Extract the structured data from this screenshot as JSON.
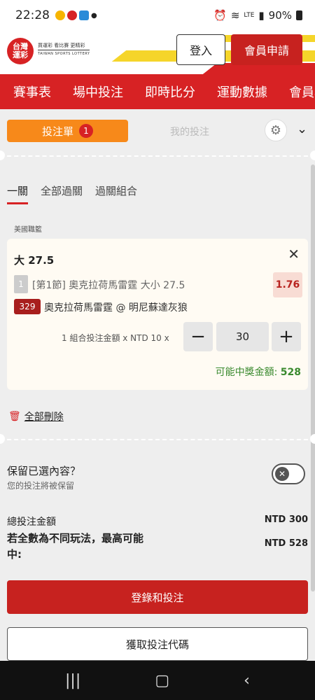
{
  "status_bar": {
    "time": "22:28",
    "battery": "90%",
    "network": "LTE"
  },
  "header": {
    "logo_text": "台灣\n運彩",
    "logo_tagline": "買運彩 看比賽 更精彩",
    "logo_sub": "TAIWAN SPORTS LOTTERY",
    "login_label": "登入",
    "register_label": "會員申請"
  },
  "nav": {
    "items": [
      "賽事表",
      "場中投注",
      "即時比分",
      "運動數據",
      "會員專"
    ]
  },
  "slip": {
    "tab_slip_label": "投注單",
    "slip_count": "1",
    "tab_mine_label": "我的投注",
    "subtabs": [
      "一關",
      "全部過關",
      "過關組合"
    ],
    "league": "美國職籃",
    "bet": {
      "selection": "大 27.5",
      "leg_number": "1",
      "market": "[第1節] 奧克拉荷馬雷霆 大小 27.5",
      "odds": "1.76",
      "game_code": "329",
      "match": "奧克拉荷馬雷霆 @ 明尼蘇達灰狼",
      "stake_label": "1 組合投注金額 x NTD 10 x",
      "stake_value": "30",
      "payout_label": "可能中獎金額: ",
      "payout_value": "528"
    },
    "delete_all": "全部刪除",
    "keep_title": "保留已選內容？",
    "keep_sub": "您的投注將被保留",
    "total_label": "總投注金額",
    "total_value": "NTD 300",
    "max_label": "若全數為不同玩法，最高可能中:",
    "max_value": "NTD 528",
    "login_bet_label": "登錄和投注",
    "get_code_label": "獲取投注代碼"
  },
  "colors": {
    "brand_red": "#d72224",
    "slip_orange": "#f7891a",
    "accent_yellow": "#f5d52a",
    "payout_green": "#3a8a2e"
  }
}
